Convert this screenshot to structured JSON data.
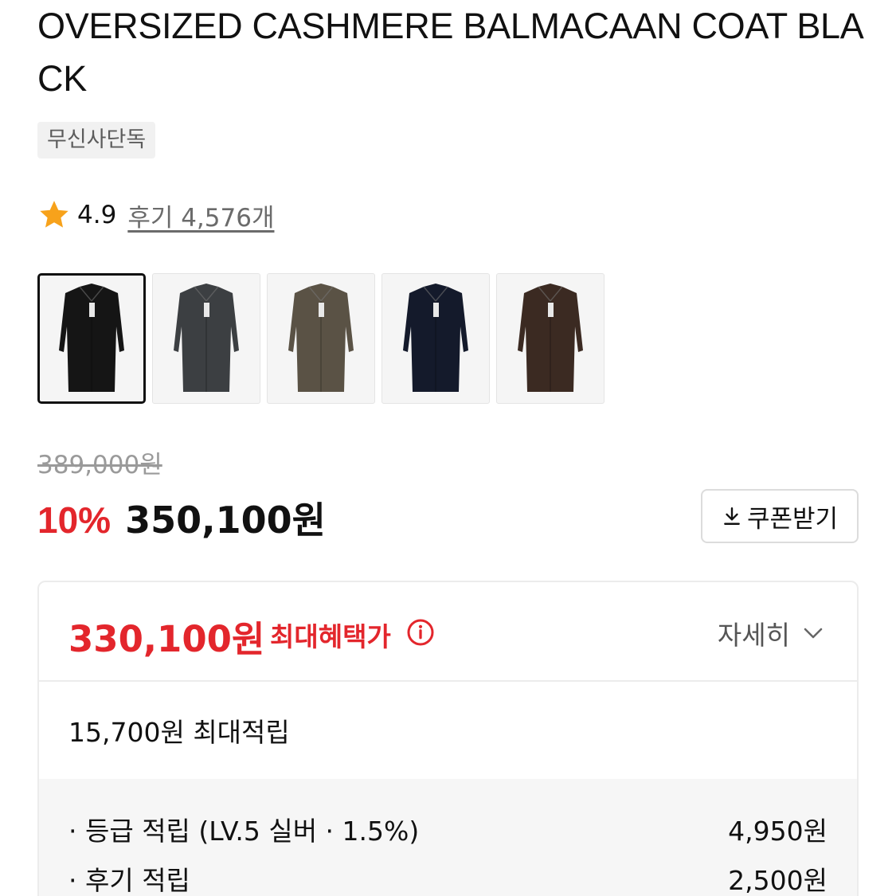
{
  "product": {
    "title": "OVERSIZED CASHMERE BALMACAAN COAT BLACK",
    "badge": "무신사단독",
    "rating": "4.9",
    "reviews": "후기 4,576개"
  },
  "colors": [
    {
      "icon": "coat-black",
      "fill": "#151515",
      "selected": true
    },
    {
      "icon": "coat-charcoal",
      "fill": "#3c3f42",
      "selected": false
    },
    {
      "icon": "coat-khaki",
      "fill": "#5a5245",
      "selected": false
    },
    {
      "icon": "coat-navy",
      "fill": "#141a2b",
      "selected": false
    },
    {
      "icon": "coat-brown",
      "fill": "#3b2a22",
      "selected": false
    }
  ],
  "pricing": {
    "original": "389,000원",
    "discount": "10%",
    "price": "350,100원",
    "coupon_label": "쿠폰받기"
  },
  "benefit": {
    "max_price": "330,100원",
    "max_label": "최대혜택가",
    "detail_label": "자세히",
    "accrual": "15,700원 최대적립",
    "rows": [
      {
        "label": "· 등급 적립 (LV.5 실버 · 1.5%)",
        "value": "4,950원"
      },
      {
        "label": "· 후기 적립",
        "value": "2,500원"
      }
    ]
  },
  "theme": {
    "accent": "#e3262c",
    "star": "#f7a21b"
  }
}
